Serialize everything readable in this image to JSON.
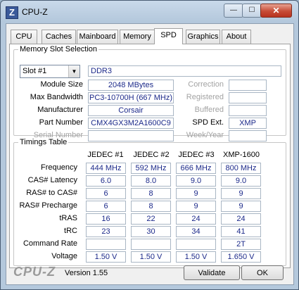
{
  "window": {
    "title": "CPU-Z",
    "icon_letter": "Z",
    "close_glyph": "✕",
    "min_glyph": "—",
    "max_glyph": "☐"
  },
  "tabs": [
    "CPU",
    "Caches",
    "Mainboard",
    "Memory",
    "SPD",
    "Graphics",
    "About"
  ],
  "active_tab": "SPD",
  "slot": {
    "legend": "Memory Slot Selection",
    "selected": "Slot #1",
    "type": "DDR3",
    "module_size_label": "Module Size",
    "module_size": "2048 MBytes",
    "max_bandwidth_label": "Max Bandwidth",
    "max_bandwidth": "PC3-10700H (667 MHz)",
    "manufacturer_label": "Manufacturer",
    "manufacturer": "Corsair",
    "part_number_label": "Part Number",
    "part_number": "CMX4GX3M2A1600C9",
    "serial_number_label": "Serial Number",
    "serial_number": "",
    "correction_label": "Correction",
    "correction": "",
    "registered_label": "Registered",
    "registered": "",
    "buffered_label": "Buffered",
    "buffered": "",
    "spd_ext_label": "SPD Ext.",
    "spd_ext": "XMP",
    "week_year_label": "Week/Year",
    "week_year": ""
  },
  "timings": {
    "legend": "Timings Table",
    "columns": [
      "JEDEC #1",
      "JEDEC #2",
      "JEDEC #3",
      "XMP-1600"
    ],
    "rows": [
      {
        "label": "Frequency",
        "values": [
          "444 MHz",
          "592 MHz",
          "666 MHz",
          "800 MHz"
        ]
      },
      {
        "label": "CAS# Latency",
        "values": [
          "6.0",
          "8.0",
          "9.0",
          "9.0"
        ]
      },
      {
        "label": "RAS# to CAS#",
        "values": [
          "6",
          "8",
          "9",
          "9"
        ]
      },
      {
        "label": "RAS# Precharge",
        "values": [
          "6",
          "8",
          "9",
          "9"
        ]
      },
      {
        "label": "tRAS",
        "values": [
          "16",
          "22",
          "24",
          "24"
        ]
      },
      {
        "label": "tRC",
        "values": [
          "23",
          "30",
          "34",
          "41"
        ]
      },
      {
        "label": "Command Rate",
        "values": [
          "",
          "",
          "",
          "2T"
        ]
      },
      {
        "label": "Voltage",
        "values": [
          "1.50 V",
          "1.50 V",
          "1.50 V",
          "1.650 V"
        ]
      }
    ]
  },
  "footer": {
    "logo": "CPU-Z",
    "version": "Version 1.55",
    "validate": "Validate",
    "ok": "OK"
  }
}
